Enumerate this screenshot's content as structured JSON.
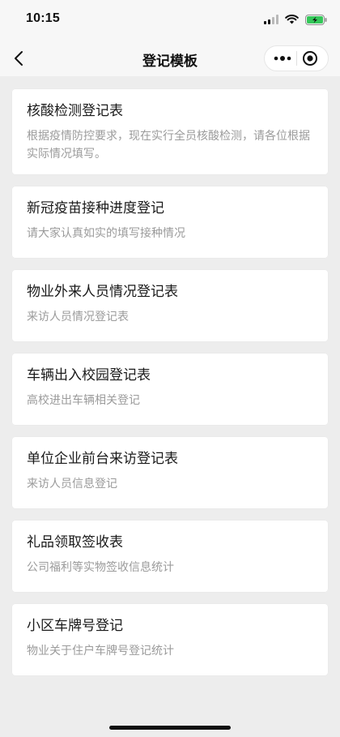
{
  "status_bar": {
    "time": "10:15",
    "icons": [
      "cellular-signal-icon",
      "wifi-icon",
      "battery-charging-icon"
    ],
    "battery_color": "#34c759"
  },
  "nav": {
    "title": "登记模板",
    "back_icon": "chevron-left-icon",
    "more_icon": "more-dots-icon",
    "close_icon": "target-close-icon"
  },
  "templates": [
    {
      "title": "核酸检测登记表",
      "desc": "根据疫情防控要求，现在实行全员核酸检测，请各位根据实际情况填写。"
    },
    {
      "title": "新冠疫苗接种进度登记",
      "desc": "请大家认真如实的填写接种情况"
    },
    {
      "title": "物业外来人员情况登记表",
      "desc": "来访人员情况登记表"
    },
    {
      "title": "车辆出入校园登记表",
      "desc": "高校进出车辆相关登记"
    },
    {
      "title": "单位企业前台来访登记表",
      "desc": "来访人员信息登记"
    },
    {
      "title": "礼品领取签收表",
      "desc": "公司福利等实物签收信息统计"
    },
    {
      "title": "小区车牌号登记",
      "desc": "物业关于住户车牌号登记统计"
    }
  ]
}
